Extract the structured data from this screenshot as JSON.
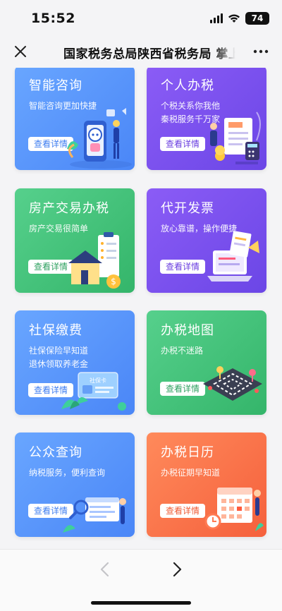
{
  "status_bar": {
    "time": "15:52",
    "battery": "74"
  },
  "nav": {
    "title": "国家税务总局陕西省税务局 掌上办税"
  },
  "cards": [
    {
      "title": "智能咨询",
      "desc": "智能咨询更加快捷",
      "button": "查看详情",
      "color": "#5a96fb",
      "icon": "robot-phone-icon"
    },
    {
      "title": "个人办税",
      "desc": "个税关系你我他\n秦税服务千万家",
      "button": "查看详情",
      "color": "#7c50ef",
      "icon": "tax-document-icon"
    },
    {
      "title": "房产交易办税",
      "desc": "房产交易很简单",
      "button": "查看详情",
      "color": "#45c27b",
      "icon": "house-checklist-icon"
    },
    {
      "title": "代开发票",
      "desc": "放心靠谱，操作便捷",
      "button": "查看详情",
      "color": "#7c50ef",
      "icon": "invoice-laptop-icon"
    },
    {
      "title": "社保缴费",
      "desc": "社保保险早知道\n退休领取养老金",
      "button": "查看详情",
      "color": "#5a96fb",
      "icon": "social-security-card-icon"
    },
    {
      "title": "办税地图",
      "desc": "办税不迷路",
      "button": "查看详情",
      "color": "#45c27b",
      "icon": "map-icon"
    },
    {
      "title": "公众查询",
      "desc": "纳税服务，便利查询",
      "button": "查看详情",
      "color": "#5a96fb",
      "icon": "search-browser-icon"
    },
    {
      "title": "办税日历",
      "desc": "办税征期早知道",
      "button": "查看详情",
      "color": "#f5703f",
      "icon": "calendar-icon"
    }
  ],
  "social_card_text": "社保卡"
}
